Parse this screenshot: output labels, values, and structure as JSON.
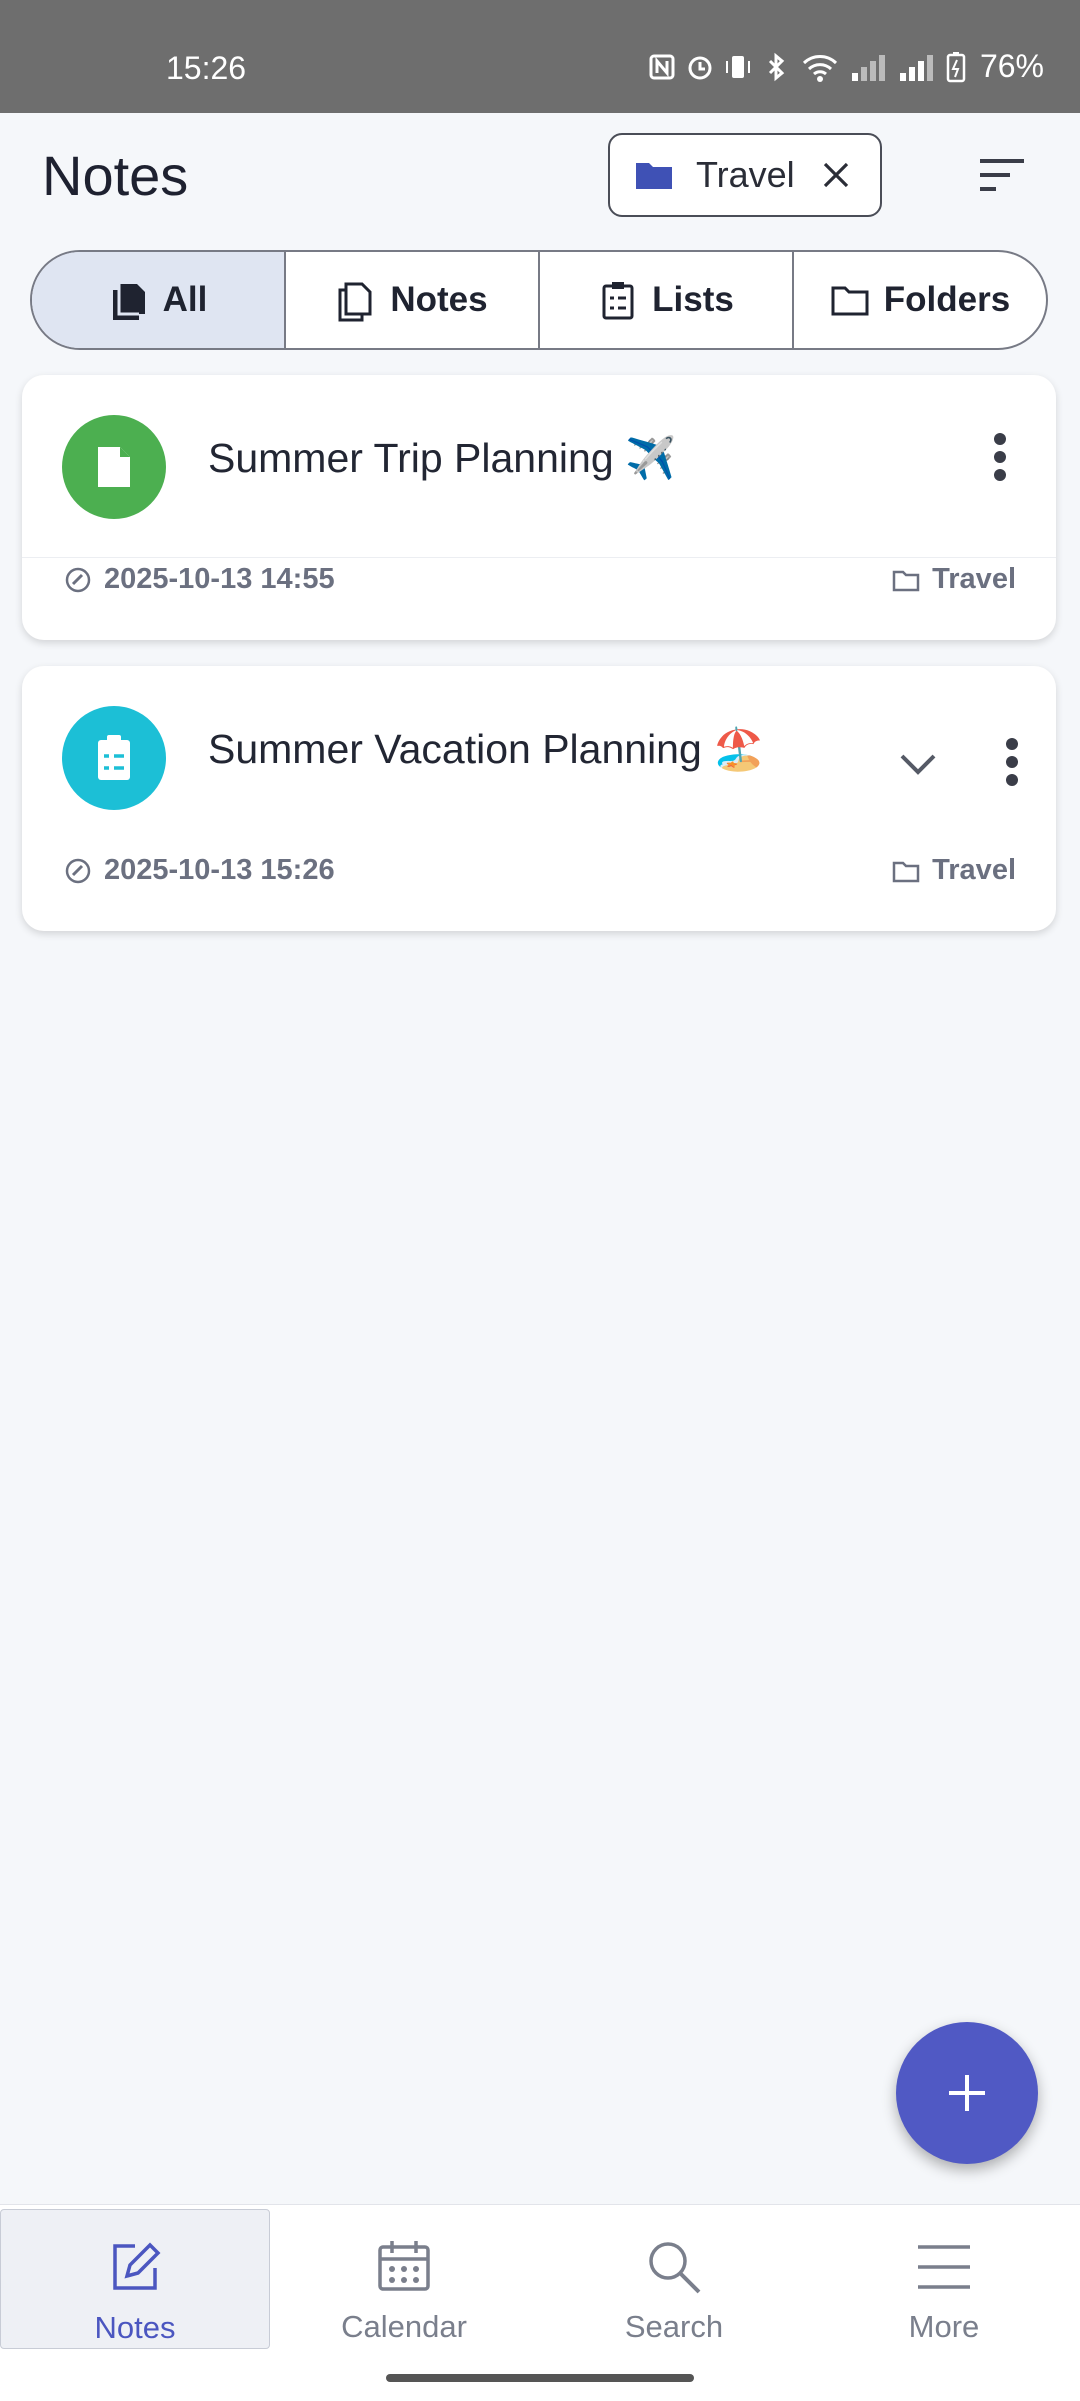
{
  "status_bar": {
    "time": "15:26",
    "battery": "76%"
  },
  "header": {
    "title": "Notes",
    "filter_chip": {
      "label": "Travel",
      "color": "#3f51b5"
    },
    "sort_icon": "sort-icon"
  },
  "tabs": [
    {
      "label": "All",
      "icon": "notes-filled-icon",
      "active": true
    },
    {
      "label": "Notes",
      "icon": "notes-outline-icon",
      "active": false
    },
    {
      "label": "Lists",
      "icon": "checklist-icon",
      "active": false
    },
    {
      "label": "Folders",
      "icon": "folder-icon",
      "active": false
    }
  ],
  "notes": [
    {
      "title": "Summer Trip Planning ✈️",
      "date": "2025-10-13 14:55",
      "folder": "Travel",
      "type": "note",
      "avatar_color": "#4caf50"
    },
    {
      "title": "Summer Vacation Planning 🏖️",
      "date": "2025-10-13 15:26",
      "folder": "Travel",
      "type": "list",
      "avatar_color": "#1cbfd6"
    }
  ],
  "fab": {
    "icon": "plus-icon",
    "color": "#5059c4"
  },
  "bottom_nav": [
    {
      "label": "Notes",
      "icon": "edit-icon",
      "active": true
    },
    {
      "label": "Calendar",
      "icon": "calendar-icon",
      "active": false
    },
    {
      "label": "Search",
      "icon": "search-icon",
      "active": false
    },
    {
      "label": "More",
      "icon": "menu-icon",
      "active": false
    }
  ]
}
